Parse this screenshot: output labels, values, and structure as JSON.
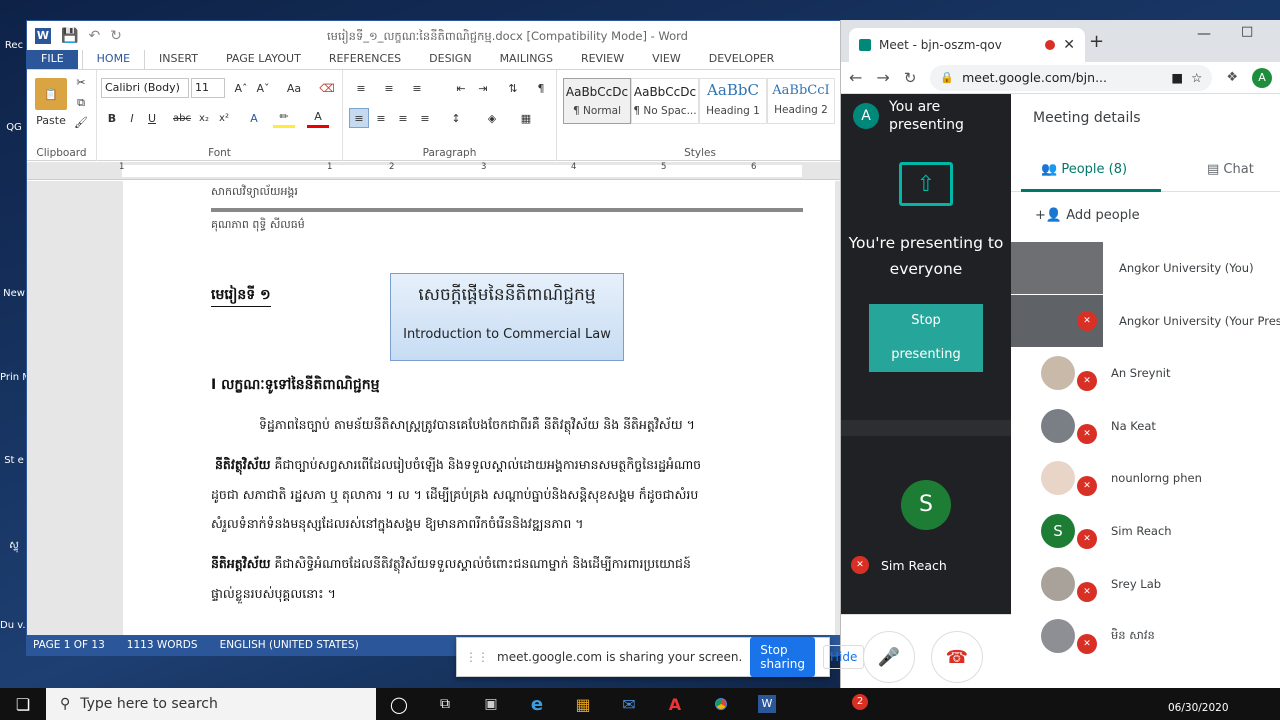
{
  "desktop": {
    "icons": [
      "Rec",
      "QG",
      "New",
      "Prin Ma",
      "St e",
      "ស្ទុ",
      "Du v.4"
    ]
  },
  "word": {
    "title": "មេរៀនទី_១_លក្ខណៈនៃនីតិពាណិជ្ជកម្ម.docx [Compatibility Mode] - Word",
    "tabs": [
      "FILE",
      "HOME",
      "INSERT",
      "PAGE LAYOUT",
      "REFERENCES",
      "DESIGN",
      "MAILINGS",
      "REVIEW",
      "VIEW",
      "DEVELOPER"
    ],
    "ribbon": {
      "paste": "Paste",
      "font_name": "Calibri (Body)",
      "font_size": "11",
      "groups": {
        "clipboard": "Clipboard",
        "font": "Font",
        "paragraph": "Paragraph",
        "styles": "Styles"
      },
      "styles": [
        {
          "preview": "AaBbCcDc",
          "name": "¶ Normal"
        },
        {
          "preview": "AaBbCcDc",
          "name": "¶ No Spac..."
        },
        {
          "preview": "AaBbC",
          "name": "Heading 1"
        },
        {
          "preview": "AaBbCcI",
          "name": "Heading 2"
        }
      ]
    },
    "ruler_numbers": [
      "1",
      "1",
      "2",
      "3",
      "4",
      "5",
      "6"
    ],
    "doc": {
      "header_line1": "សាកលវិទ្យាល័យអង្គរ",
      "header_line2": "គុណភាព ពុទ្ធិ សីលធម៌",
      "lesson": "មេរៀនទី ១",
      "box_kh": "សេចក្តីផ្តើមនៃនីតិពាណិជ្ជកម្ម",
      "box_en": "Introduction to Commercial Law",
      "heading1": "I លក្ខណៈទូទៅនៃនីតិពាណិជ្ជកម្ម",
      "p1": "ទិដ្ឋភាពនៃច្បាប់ តាមន័យនីតិសាស្ត្រត្រូវបានគេបែងចែកជាពីរគឺ នីតិវត្ថុវិស័យ និង នីតិអត្តវិស័យ ។",
      "p2_bold": "នីតិវត្ថុវិស័យ",
      "p2_line1": " គឺជាច្បាប់សព្វសារពើដែលរៀបចំឡើង និងទទួលស្គាល់ដោយអង្គការមានសមត្ថកិច្ចនៃរដ្ឋអំណាច",
      "p2_line2": "ដូចជា សភាជាតិ រដ្ឋសភា ឬ តុលាការ ។ ល ។ ដើម្បីគ្រប់គ្រង សណ្តាប់ធ្នាប់និងសន្តិសុខសង្គម ក៏ដូចជាសំរប",
      "p2_line3": "សំរួលទំនាក់ទំនងមនុស្សដែលរស់នៅក្នុងសង្គម ឱ្យមានភាពរីកចំរើននិងវឌ្ឍនភាព ។",
      "p3_bold": "នីតិអត្តវិស័យ",
      "p3_line1": " គឺជាសិទ្ធិអំណាចដែលនីតិវត្ថុវិស័យទទួលស្គាល់ចំពោះជនណាម្នាក់ និងដើម្បីការពារប្រយោជន៍",
      "p3_line2": "ផ្ទាល់ខ្លួនរបស់បុគ្គលនោះ ។"
    },
    "status": {
      "page": "PAGE 1 OF 13",
      "words": "1113 WORDS",
      "language": "ENGLISH (UNITED STATES)"
    }
  },
  "chrome": {
    "tab_title": "Meet - bjn-oszm-qov",
    "url": "meet.google.com/bjn...",
    "avatar_letter": "A"
  },
  "meet": {
    "presenting_top": "You are presenting",
    "presenting_msg": "You're presenting to everyone",
    "stop_button": "Stop presenting",
    "tile_name": "Sim Reach",
    "tile_letter": "S",
    "panel_title": "Meeting details",
    "people_tab": "People (8)",
    "chat_tab": "Chat",
    "add_people": "Add people",
    "people": [
      {
        "name": "Angkor University (You)",
        "color": "#6d6f73",
        "muted": false
      },
      {
        "name": "Angkor University (Your Prese",
        "color": "#5f6368",
        "muted": true
      },
      {
        "name": "An Sreynit",
        "color": "#c9b9a8",
        "muted": true
      },
      {
        "name": "Na Keat",
        "color": "#7a7f86",
        "muted": true
      },
      {
        "name": "nounlorng phen",
        "color": "#e8d5c8",
        "muted": true
      },
      {
        "name": "Sim Reach",
        "color": "#1e7d34",
        "muted": true,
        "letter": "S"
      },
      {
        "name": "Srey Lab",
        "color": "#a8a29a",
        "muted": true
      },
      {
        "name": "មិន សាវន",
        "color": "#8d8f94",
        "muted": true
      }
    ]
  },
  "sharebar": {
    "message": "meet.google.com is sharing your screen.",
    "stop": "Stop sharing",
    "hide": "Hide"
  },
  "taskbar": {
    "search_placeholder": "Type here to search",
    "date": "06/30/2020",
    "badge": "2"
  },
  "colors": {
    "word_blue": "#2b579a",
    "meet_teal": "#00897b",
    "meet_red": "#d93025",
    "link_blue": "#1a73e8"
  }
}
